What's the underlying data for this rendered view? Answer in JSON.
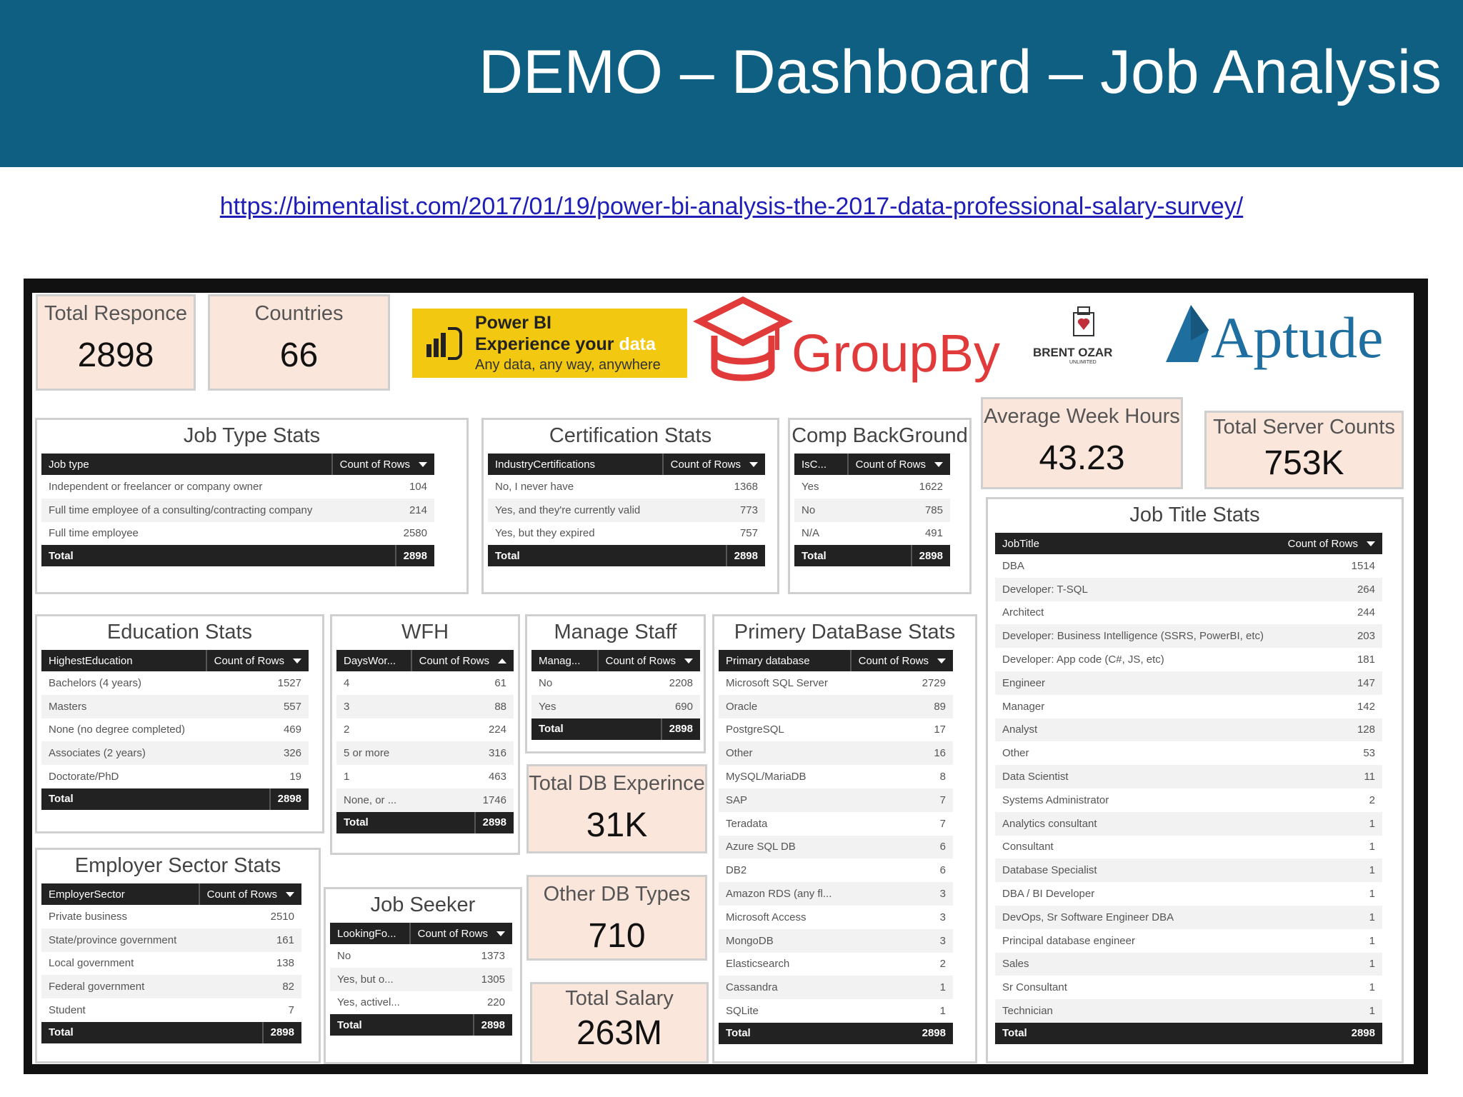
{
  "slide": {
    "title": "DEMO – Dashboard – Job Analysis",
    "url": "https://bimentalist.com/2017/01/19/power-bi-analysis-the-2017-data-professional-salary-survey/"
  },
  "kpis": {
    "total_response": {
      "label": "Total Responce",
      "value": "2898"
    },
    "countries": {
      "label": "Countries",
      "value": "66"
    },
    "avg_week_hours": {
      "label": "Average Week Hours",
      "value": "43.23"
    },
    "total_server_counts": {
      "label": "Total Server Counts",
      "value": "753K"
    },
    "total_db_experience": {
      "label": "Total DB Experince",
      "value": "31K"
    },
    "other_db_types": {
      "label": "Other DB Types",
      "value": "710"
    },
    "total_salary": {
      "label": "Total Salary",
      "value": "263M"
    }
  },
  "logos": {
    "powerbi": {
      "line1": "Power BI",
      "line2a": "Experience your ",
      "line2b": "data",
      "line3": "Any data, any way, anywhere",
      "color": "#f2c811"
    },
    "groupby": {
      "text": "GroupBy",
      "color": "#e03a3a"
    },
    "brentozar": {
      "text": "BRENT OZAR",
      "sub": "UNLIMITED"
    },
    "aptude": {
      "text": "Aptude",
      "color": "#1e6fa0"
    }
  },
  "job_type": {
    "title": "Job Type Stats",
    "h1": "Job type",
    "h2": "Count of Rows",
    "rows": [
      [
        "Independent or freelancer or company owner",
        "104"
      ],
      [
        "Full time employee of a consulting/contracting company",
        "214"
      ],
      [
        "Full time employee",
        "2580"
      ]
    ],
    "total": [
      "Total",
      "2898"
    ]
  },
  "certification": {
    "title": "Certification Stats",
    "h1": "IndustryCertifications",
    "h2": "Count of Rows",
    "rows": [
      [
        "No, I never have",
        "1368"
      ],
      [
        "Yes, and they're currently valid",
        "773"
      ],
      [
        "Yes, but they expired",
        "757"
      ]
    ],
    "total": [
      "Total",
      "2898"
    ]
  },
  "comp_background": {
    "title": "Comp BackGround",
    "h1": "IsC...",
    "h2": "Count of Rows",
    "rows": [
      [
        "Yes",
        "1622"
      ],
      [
        "No",
        "785"
      ],
      [
        "N/A",
        "491"
      ]
    ],
    "total": [
      "Total",
      "2898"
    ]
  },
  "job_title": {
    "title": "Job Title Stats",
    "h1": "JobTitle",
    "h2": "Count of Rows",
    "rows": [
      [
        "DBA",
        "1514"
      ],
      [
        "Developer: T-SQL",
        "264"
      ],
      [
        "Architect",
        "244"
      ],
      [
        "Developer: Business Intelligence (SSRS, PowerBI, etc)",
        "203"
      ],
      [
        "Developer: App code (C#, JS, etc)",
        "181"
      ],
      [
        "Engineer",
        "147"
      ],
      [
        "Manager",
        "142"
      ],
      [
        "Analyst",
        "128"
      ],
      [
        "Other",
        "53"
      ],
      [
        "Data Scientist",
        "11"
      ],
      [
        "Systems Administrator",
        "2"
      ],
      [
        "Analytics consultant",
        "1"
      ],
      [
        "Consultant",
        "1"
      ],
      [
        "Database Specialist",
        "1"
      ],
      [
        "DBA / BI Developer",
        "1"
      ],
      [
        "DevOps, Sr Software Engineer DBA",
        "1"
      ],
      [
        "Principal database engineer",
        "1"
      ],
      [
        "Sales",
        "1"
      ],
      [
        "Sr Consultant",
        "1"
      ],
      [
        "Technician",
        "1"
      ]
    ],
    "total": [
      "Total",
      "2898"
    ]
  },
  "education": {
    "title": "Education Stats",
    "h1": "HighestEducation",
    "h2": "Count of Rows",
    "rows": [
      [
        "Bachelors (4 years)",
        "1527"
      ],
      [
        "Masters",
        "557"
      ],
      [
        "None (no degree completed)",
        "469"
      ],
      [
        "Associates (2 years)",
        "326"
      ],
      [
        "Doctorate/PhD",
        "19"
      ]
    ],
    "total": [
      "Total",
      "2898"
    ]
  },
  "wfh": {
    "title": "WFH",
    "h1": "DaysWor...",
    "h2": "Count of Rows",
    "rows": [
      [
        "4",
        "61"
      ],
      [
        "3",
        "88"
      ],
      [
        "2",
        "224"
      ],
      [
        "5 or more",
        "316"
      ],
      [
        "1",
        "463"
      ],
      [
        "None, or ...",
        "1746"
      ]
    ],
    "total": [
      "Total",
      "2898"
    ]
  },
  "manage_staff": {
    "title": "Manage Staff",
    "h1": "Manag...",
    "h2": "Count of Rows",
    "rows": [
      [
        "No",
        "2208"
      ],
      [
        "Yes",
        "690"
      ]
    ],
    "total": [
      "Total",
      "2898"
    ]
  },
  "primary_db": {
    "title": "Primery DataBase Stats",
    "h1": "Primary database",
    "h2": "Count of Rows",
    "rows": [
      [
        "Microsoft SQL Server",
        "2729"
      ],
      [
        "Oracle",
        "89"
      ],
      [
        "PostgreSQL",
        "17"
      ],
      [
        "Other",
        "16"
      ],
      [
        "MySQL/MariaDB",
        "8"
      ],
      [
        "SAP",
        "7"
      ],
      [
        "Teradata",
        "7"
      ],
      [
        "Azure SQL DB",
        "6"
      ],
      [
        "DB2",
        "6"
      ],
      [
        "Amazon RDS (any fl...",
        "3"
      ],
      [
        "Microsoft Access",
        "3"
      ],
      [
        "MongoDB",
        "3"
      ],
      [
        "Elasticsearch",
        "2"
      ],
      [
        "Cassandra",
        "1"
      ],
      [
        "SQLite",
        "1"
      ]
    ],
    "total": [
      "Total",
      "2898"
    ]
  },
  "employer_sector": {
    "title": "Employer Sector Stats",
    "h1": "EmployerSector",
    "h2": "Count of Rows",
    "rows": [
      [
        "Private business",
        "2510"
      ],
      [
        "State/province government",
        "161"
      ],
      [
        "Local government",
        "138"
      ],
      [
        "Federal government",
        "82"
      ],
      [
        "Student",
        "7"
      ]
    ],
    "total": [
      "Total",
      "2898"
    ]
  },
  "job_seeker": {
    "title": "Job Seeker",
    "h1": "LookingFo...",
    "h2": "Count of Rows",
    "rows": [
      [
        "No",
        "1373"
      ],
      [
        "Yes, but o...",
        "1305"
      ],
      [
        "Yes, activel...",
        "220"
      ]
    ],
    "total": [
      "Total",
      "2898"
    ]
  }
}
